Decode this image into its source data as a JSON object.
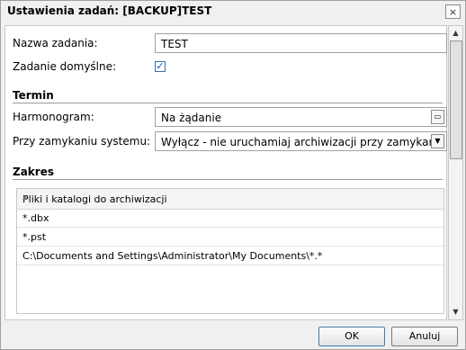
{
  "window": {
    "title": "Ustawienia zadań: [BACKUP]TEST",
    "close_label": "×"
  },
  "general": {
    "task_name_label": "Nazwa zadania:",
    "task_name_value": "TEST",
    "default_task_label": "Zadanie domyślne:",
    "default_task_checked": true
  },
  "schedule": {
    "section_title": "Termin",
    "harmonogram_label": "Harmonogram:",
    "harmonogram_value": "Na żądanie",
    "shutdown_label": "Przy zamykaniu systemu:",
    "shutdown_value": "Wyłącz - nie uruchamiaj archiwizacji przy zamykaniu systemu"
  },
  "scope": {
    "section_title": "Zakres",
    "column_header": "Pliki i katalogi do archiwizacji",
    "items": [
      "*.dbx",
      "*.pst",
      "C:\\Documents and Settings\\Administrator\\My Documents\\*.*"
    ]
  },
  "footer": {
    "ok_label": "OK",
    "cancel_label": "Anuluj"
  }
}
